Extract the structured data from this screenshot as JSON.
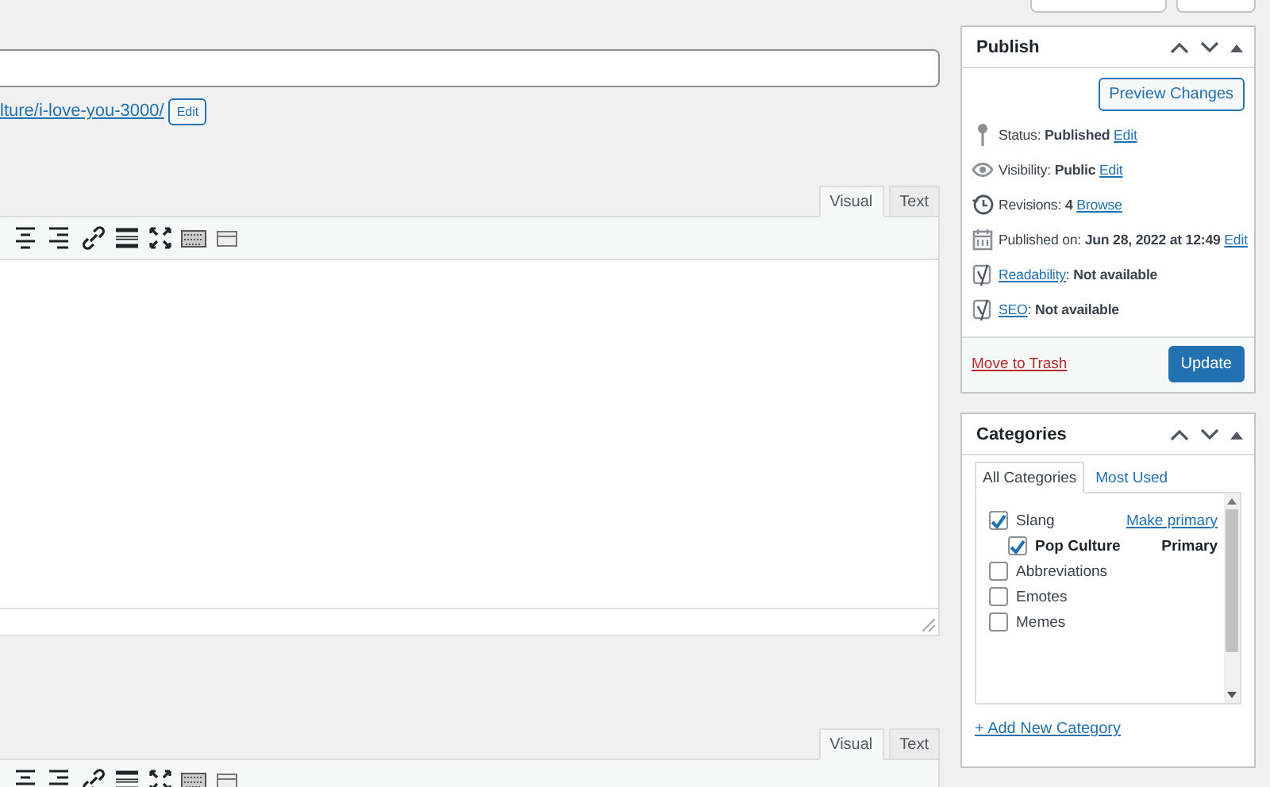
{
  "permalink": {
    "url": "lture/i-love-you-3000/",
    "edit_button": "Edit"
  },
  "editors": [
    {
      "tabs": [
        {
          "label": "Visual",
          "selected": true
        },
        {
          "label": "Text",
          "selected": false
        }
      ]
    },
    {
      "tabs": [
        {
          "label": "Visual",
          "selected": true
        },
        {
          "label": "Text",
          "selected": false
        }
      ]
    }
  ],
  "publish": {
    "title": "Publish",
    "preview_button": "Preview Changes",
    "rows": [
      {
        "kind": "status",
        "text": "Status: **Published**",
        "link": "Edit"
      },
      {
        "kind": "visibility",
        "text": "Visibility: **Public**",
        "link": "Edit"
      },
      {
        "kind": "revisions",
        "text": "Revisions: **4**",
        "link": "Browse"
      },
      {
        "kind": "date",
        "text": "Published on: **Jun 28, 2022 at 12:49**",
        "link": "Edit"
      },
      {
        "kind": "yoast",
        "link": "Readability",
        "text": ": **Not available**"
      },
      {
        "kind": "yoast",
        "link": "SEO",
        "text": ": **Not available**"
      }
    ],
    "trash_link": "Move to Trash",
    "update_button": "Update"
  },
  "categories": {
    "title": "Categories",
    "tabs": [
      {
        "label": "All Categories",
        "selected": true
      },
      {
        "label": "Most Used",
        "selected": false
      }
    ],
    "items": [
      {
        "label": "Slang",
        "checked": true,
        "action": "Make primary",
        "children": [
          {
            "label": "Pop Culture",
            "checked": true,
            "badge": "Primary"
          }
        ]
      },
      {
        "label": "Abbreviations",
        "checked": false
      },
      {
        "label": "Emotes",
        "checked": false
      },
      {
        "label": "Memes",
        "checked": false
      }
    ],
    "add_link": "+ Add New Category"
  }
}
